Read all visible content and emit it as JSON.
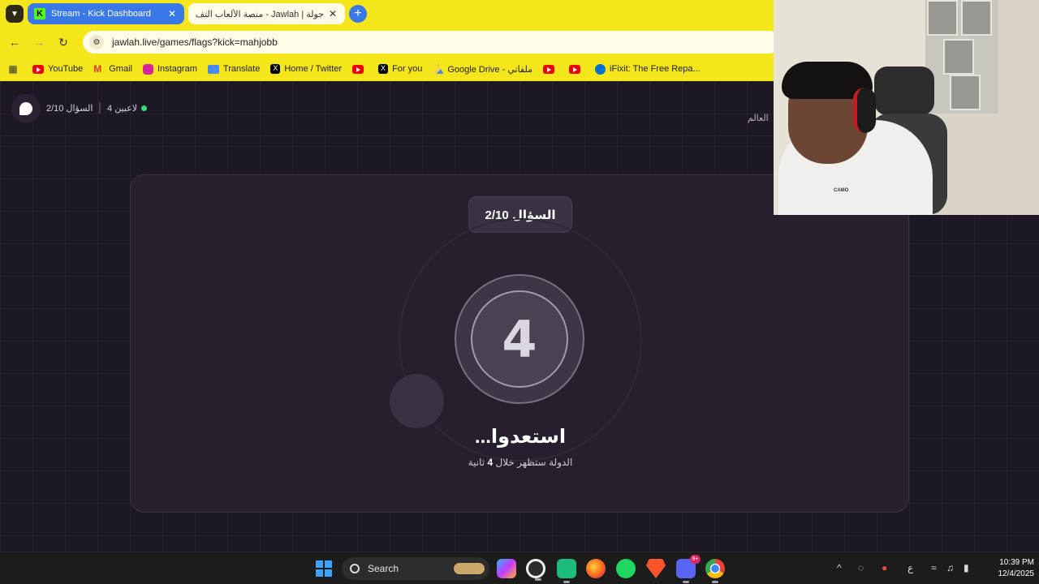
{
  "browser": {
    "tabs": [
      {
        "label": "Stream - Kick Dashboard",
        "favicon": "kick-icon",
        "active": false
      },
      {
        "label": "جولة | Jawlah - منصة الألعاب التف",
        "favicon": "jawlah-icon",
        "active": true
      }
    ],
    "url": "jawlah.live/games/flags?kick=mahjobb",
    "bookmarks": [
      {
        "label": "YouTube",
        "icon": "youtube-icon"
      },
      {
        "label": "Gmail",
        "icon": "gmail-icon"
      },
      {
        "label": "Instagram",
        "icon": "instagram-icon"
      },
      {
        "label": "Translate",
        "icon": "translate-icon"
      },
      {
        "label": "Home / Twitter",
        "icon": "x-icon"
      },
      {
        "label": "",
        "icon": "youtube-icon"
      },
      {
        "label": "For you",
        "icon": "x-icon"
      },
      {
        "label": "Google Drive - ملفاتي",
        "icon": "google-drive-icon"
      },
      {
        "label": "",
        "icon": "youtube-icon"
      },
      {
        "label": "",
        "icon": "youtube-icon"
      },
      {
        "label": "iFixit: The Free Repa...",
        "icon": "ifixit-icon"
      }
    ],
    "accent_color": "#f5e61b"
  },
  "game": {
    "question_counter": "السؤال 2/10",
    "players": "4 لاعبين",
    "world_label": "العالم",
    "question_badge": "السؤال 2/10",
    "countdown": "4",
    "ready_text": "استعدوا...",
    "subtitle_before": "الدولة ستظهر خلال",
    "subtitle_number": "4",
    "subtitle_after": "ثانية",
    "online_color": "#2ee07a"
  },
  "webcam": {
    "shirt_text": "CAMO"
  },
  "taskbar": {
    "search_label": "Search",
    "apps": [
      "copilot-icon",
      "obs-icon",
      "kick-studio-icon",
      "firefox-icon",
      "spotify-icon",
      "brave-icon",
      "discord-icon",
      "chrome-icon"
    ],
    "discord_badge": "9+",
    "lang": "ع",
    "time": "10:39 PM",
    "date": "12/4/2025"
  }
}
